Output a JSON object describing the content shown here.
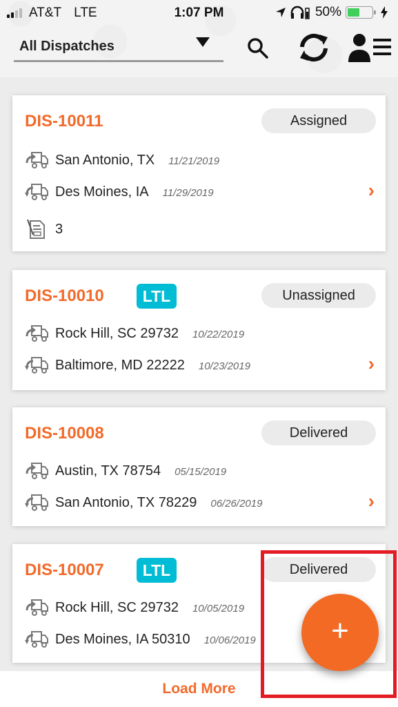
{
  "status_bar": {
    "carrier": "AT&T",
    "network": "LTE",
    "time": "1:07 PM",
    "battery_percent": "50%",
    "battery_level": 0.5,
    "signal_bars": 2,
    "signal_total": 4
  },
  "header": {
    "filter_label": "All Dispatches",
    "icons": [
      "search-icon",
      "refresh-icon",
      "user-menu-icon"
    ]
  },
  "colors": {
    "accent": "#f26a2a",
    "ltl_badge": "#00bcd4",
    "status_pill": "#ebebeb",
    "background": "#ececec"
  },
  "dispatches": [
    {
      "id": "DIS-10011",
      "ltl": false,
      "status": "Assigned",
      "origin": {
        "city": "San Antonio, TX",
        "date": "11/21/2019"
      },
      "destination": {
        "city": "Des Moines, IA",
        "date": "11/29/2019"
      },
      "documents": "3"
    },
    {
      "id": "DIS-10010",
      "ltl": true,
      "ltl_label": "LTL",
      "status": "Unassigned",
      "origin": {
        "city": "Rock Hill, SC 29732",
        "date": "10/22/2019"
      },
      "destination": {
        "city": "Baltimore, MD 22222",
        "date": "10/23/2019"
      }
    },
    {
      "id": "DIS-10008",
      "ltl": false,
      "status": "Delivered",
      "origin": {
        "city": "Austin, TX 78754",
        "date": "05/15/2019"
      },
      "destination": {
        "city": "San Antonio, TX 78229",
        "date": "06/26/2019"
      }
    },
    {
      "id": "DIS-10007",
      "ltl": true,
      "ltl_label": "LTL",
      "status": "Delivered",
      "origin": {
        "city": "Rock Hill, SC 29732",
        "date": "10/05/2019"
      },
      "destination": {
        "city": "Des Moines, IA 50310",
        "date": "10/06/2019"
      }
    }
  ],
  "footer": {
    "load_more_label": "Load More"
  },
  "fab": {
    "label": "+"
  }
}
